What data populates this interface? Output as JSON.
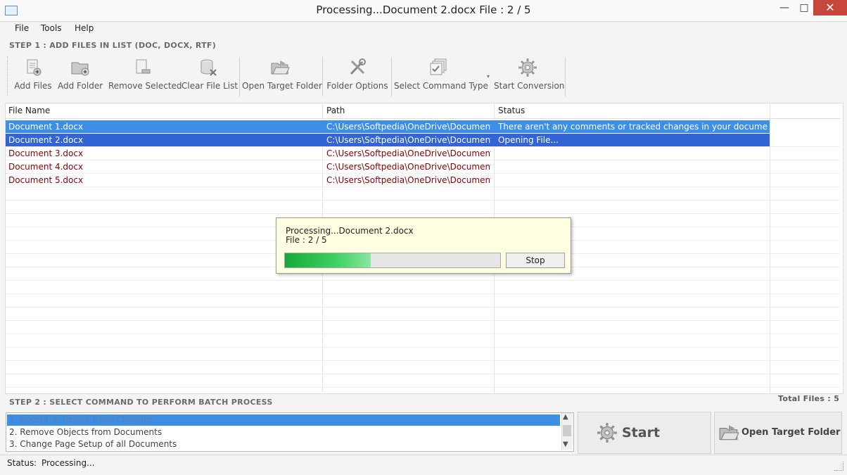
{
  "window": {
    "title": "Processing...Document 2.docx File : 2 / 5",
    "minimize": "—",
    "maximize": "□",
    "close": "✕"
  },
  "menu": [
    "File",
    "Tools",
    "Help"
  ],
  "step1": {
    "label": "STEP 1 : ADD FILES IN LIST (DOC, DOCX, RTF)"
  },
  "toolbar": {
    "add_files": "Add Files",
    "add_folder": "Add Folder",
    "remove_selected": "Remove Selected",
    "clear_file_list": "Clear File List",
    "open_target_folder": "Open Target Folder",
    "folder_options": "Folder Options",
    "select_command_type": "Select Command Type",
    "start_conversion": "Start Conversion"
  },
  "table": {
    "headers": [
      "File Name",
      "Path",
      "Status"
    ],
    "rows": [
      {
        "name": "Document 1.docx",
        "path": "C:\\Users\\Softpedia\\OneDrive\\Documents...",
        "status": "There aren't any comments or tracked changes in your document."
      },
      {
        "name": "Document 2.docx",
        "path": "C:\\Users\\Softpedia\\OneDrive\\Documents...",
        "status": "Opening File..."
      },
      {
        "name": "Document 3.docx",
        "path": "C:\\Users\\Softpedia\\OneDrive\\Documents...",
        "status": ""
      },
      {
        "name": "Document 4.docx",
        "path": "C:\\Users\\Softpedia\\OneDrive\\Documents...",
        "status": ""
      },
      {
        "name": "Document 5.docx",
        "path": "C:\\Users\\Softpedia\\OneDrive\\Documents...",
        "status": ""
      }
    ]
  },
  "progress_dialog": {
    "line1": "Processing...Document 2.docx",
    "line2": "File : 2 / 5",
    "progress_fraction": 0.4,
    "stop_label": "Stop"
  },
  "step2": {
    "label": "STEP 2 : SELECT COMMAND TO PERFORM BATCH PROCESS",
    "total_files": "Total Files : 5",
    "commands": [
      "1. Accept or Reject Track Changes",
      "2. Remove Objects from Documents",
      "3. Change Page Setup of all Documents"
    ],
    "start_label": "Start",
    "open_target_folder_label": "Open Target Folder"
  },
  "statusbar": {
    "label": "Status",
    "separator": ":",
    "value": "Processing..."
  },
  "colors": {
    "row_selected": "#3d8fe6",
    "row_active": "#3264d8",
    "file_text": "#8b0000",
    "accent_green": "#1fae43"
  }
}
